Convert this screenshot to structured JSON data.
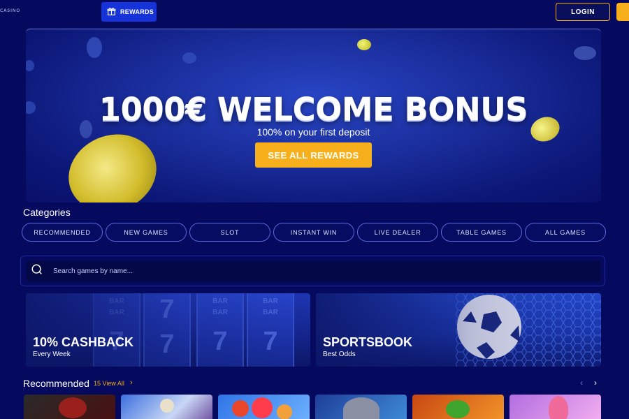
{
  "header": {
    "logo_text": "CASINO",
    "rewards_label": "REWARDS",
    "login_label": "LOGIN"
  },
  "hero": {
    "title": "1000€ WELCOME BONUS",
    "subtitle": "100% on your first deposit",
    "cta_label": "SEE ALL REWARDS"
  },
  "categories": {
    "title": "Categories",
    "items": [
      "RECOMMENDED",
      "NEW GAMES",
      "SLOT",
      "INSTANT WIN",
      "LIVE DEALER",
      "TABLE GAMES",
      "ALL GAMES"
    ]
  },
  "search": {
    "placeholder": "Search games by name..."
  },
  "promos": [
    {
      "title": "10% CASHBACK",
      "subtitle": "Every Week"
    },
    {
      "title": "SPORTSBOOK",
      "subtitle": "Best Odds"
    }
  ],
  "recommended": {
    "title": "Recommended",
    "view_all": "15 View All",
    "prev_icon": "‹",
    "next_icon": "›"
  },
  "colors": {
    "background": "#050a5e",
    "accent": "#f7b01b",
    "rewards_button": "#1533d9",
    "pill_border": "#5b6be0"
  }
}
